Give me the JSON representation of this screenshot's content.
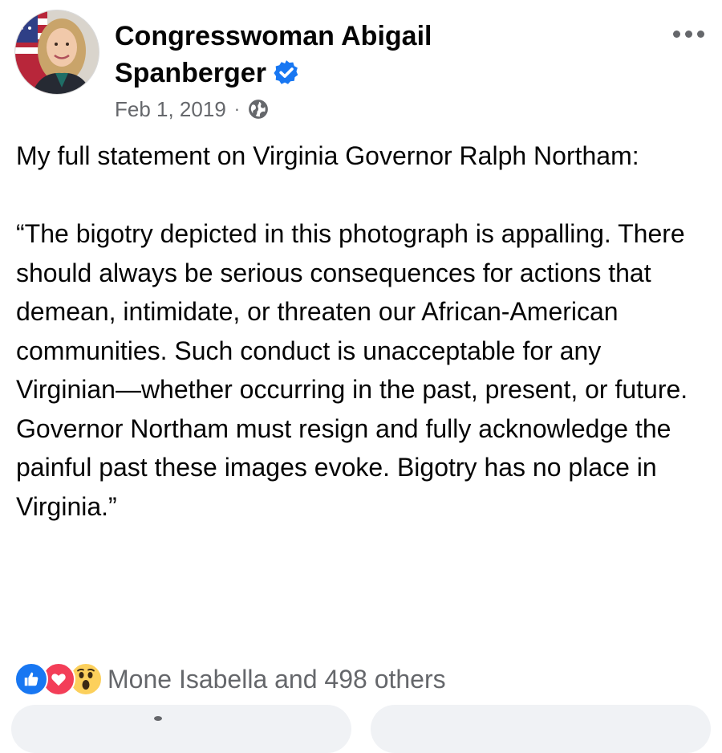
{
  "post": {
    "author": {
      "name": "Congresswoman Abigail Spanberger",
      "verified_icon": "verified-badge-icon",
      "avatar_icon": "profile-photo"
    },
    "date": "Feb 1, 2019",
    "separator": "·",
    "audience_icon": "globe-icon",
    "more_icon": "more-options-icon",
    "text": "My full statement on Virginia Governor Ralph Northam:\n\n“The bigotry depicted in this photograph is appalling. There should always be serious consequences for actions that demean, intimidate, or threaten our African-American communities. Such conduct is unacceptable for any Virginian—whether occurring in the past, present, or future. Governor Northam must resign and fully acknowledge the painful past these images evoke. Bigotry has no place in Virginia.”",
    "reactions": {
      "icons": [
        "like-icon",
        "love-icon",
        "wow-icon"
      ],
      "summary": "Mone Isabella and 498 others"
    }
  },
  "colors": {
    "text_primary": "#050505",
    "text_secondary": "#65676b",
    "verified_blue": "#1877f2",
    "like_blue": "#1877f2",
    "love_red": "#f33e58",
    "wow_yellow": "#fcd05c",
    "pill_background": "#f0f2f5"
  }
}
